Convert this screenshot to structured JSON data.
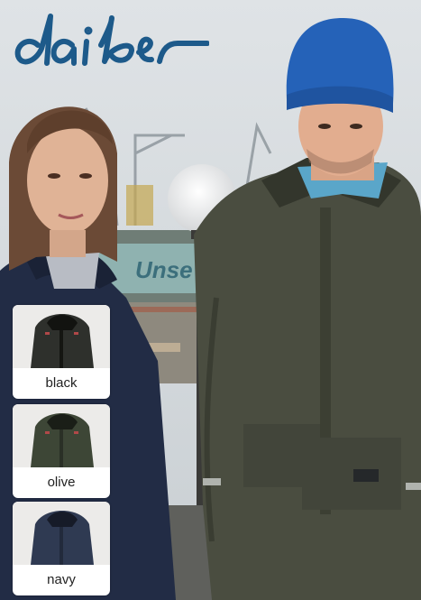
{
  "brand": {
    "name": "daiber",
    "color": "#1d5a8a"
  },
  "background_sign": "Unse",
  "variants": [
    {
      "label": "black",
      "color": "#2e302c"
    },
    {
      "label": "olive",
      "color": "#3d4636"
    },
    {
      "label": "navy",
      "color": "#2f3a52"
    }
  ]
}
